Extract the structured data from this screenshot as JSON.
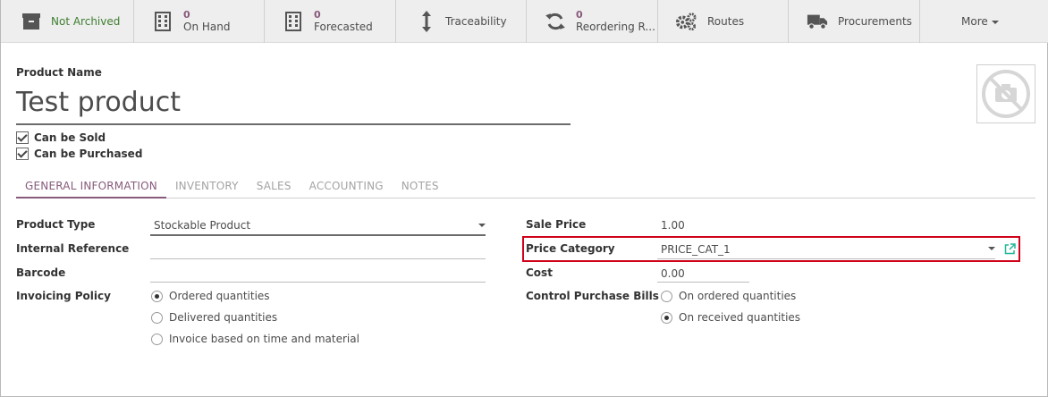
{
  "smart_buttons": [
    {
      "id": "archived",
      "label": "Not Archived",
      "icon": "archive-icon"
    },
    {
      "id": "on-hand",
      "count": "0",
      "label": "On Hand",
      "icon": "building-icon"
    },
    {
      "id": "forecasted",
      "count": "0",
      "label": "Forecasted",
      "icon": "building-icon"
    },
    {
      "id": "traceability",
      "label": "Traceability",
      "icon": "up-down-arrow-icon"
    },
    {
      "id": "reordering",
      "count": "0",
      "label": "Reordering R...",
      "icon": "refresh-icon"
    },
    {
      "id": "routes",
      "label": "Routes",
      "icon": "gears-icon"
    },
    {
      "id": "procurements",
      "label": "Procurements",
      "icon": "truck-icon"
    },
    {
      "id": "more",
      "label": "More",
      "icon": "caret-down-icon"
    }
  ],
  "header": {
    "product_name_label": "Product Name",
    "product_name": "Test product",
    "image_icon": "no-camera-icon"
  },
  "checkboxes": [
    {
      "label": "Can be Sold",
      "checked": true
    },
    {
      "label": "Can be Purchased",
      "checked": true
    }
  ],
  "tabs": [
    {
      "label": "GENERAL INFORMATION",
      "active": true
    },
    {
      "label": "INVENTORY",
      "active": false
    },
    {
      "label": "SALES",
      "active": false
    },
    {
      "label": "ACCOUNTING",
      "active": false
    },
    {
      "label": "NOTES",
      "active": false
    }
  ],
  "left_fields": {
    "product_type": {
      "label": "Product Type",
      "value": "Stockable Product"
    },
    "internal_reference": {
      "label": "Internal Reference",
      "value": ""
    },
    "barcode": {
      "label": "Barcode",
      "value": ""
    },
    "invoicing_policy": {
      "label": "Invoicing Policy",
      "options": [
        {
          "label": "Ordered quantities",
          "selected": true
        },
        {
          "label": "Delivered quantities",
          "selected": false
        },
        {
          "label": "Invoice based on time and material",
          "selected": false
        }
      ]
    }
  },
  "right_fields": {
    "sale_price": {
      "label": "Sale Price",
      "value": "1.00"
    },
    "price_category": {
      "label": "Price Category",
      "value": "PRICE_CAT_1"
    },
    "cost": {
      "label": "Cost",
      "value": "0.00"
    },
    "control_purchase_bills": {
      "label": "Control Purchase Bills",
      "options": [
        {
          "label": "On ordered quantities",
          "selected": false
        },
        {
          "label": "On received quantities",
          "selected": true
        }
      ]
    }
  },
  "colors": {
    "accent": "#875a7b",
    "archived_green": "#3e7e2f",
    "highlight_red": "#d0021b",
    "external_link": "#21b799"
  }
}
